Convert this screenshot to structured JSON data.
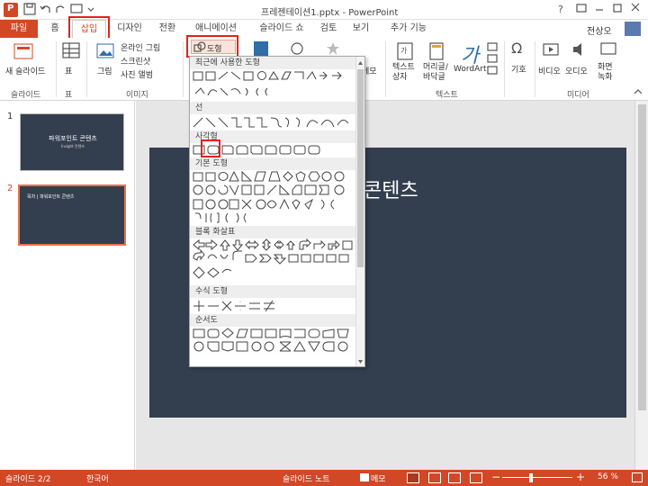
{
  "app": {
    "window_title": "프레젠테이션1.pptx - PowerPoint",
    "user": "전상오",
    "help": "?"
  },
  "tabs": [
    "파일",
    "홈",
    "삽입",
    "디자인",
    "전환",
    "애니메이션",
    "슬라이드 쇼",
    "검토",
    "보기",
    "추가 기능"
  ],
  "active_tab": "삽입",
  "ribbon": {
    "new_slide": "새 슬라이드",
    "table": "표",
    "picture": "그림",
    "online_picture": "온라인 그림",
    "screenshot": "스크린샷",
    "photo_album": "사진 앨범",
    "shapes": "도형",
    "memo": "메모",
    "textbox": "텍스트 상자",
    "header_footer": "머리글/ 바닥글",
    "wordart": "WordArt",
    "symbol": "기호",
    "video": "비디오",
    "audio": "오디오",
    "screen_record": "화면 녹화",
    "groups": {
      "slides": "슬라이드",
      "tables": "표",
      "images": "이미지",
      "text": "텍스트",
      "media": "미디어"
    }
  },
  "shapes_menu": {
    "sections": [
      "최근에 사용한 도형",
      "선",
      "사각형",
      "기본 도형",
      "블록 화살표",
      "수식 도형",
      "순서도"
    ]
  },
  "slides": [
    {
      "num": "1",
      "title": "파워포인트 콘텐츠",
      "subtitle": "Insight 컨텐츠"
    },
    {
      "num": "2",
      "title": "목차 | 파워포인트 콘텐츠"
    }
  ],
  "main_slide": {
    "title": "콘텐츠"
  },
  "statusbar": {
    "slide_info": "슬라이드 2/2",
    "language": "한국어",
    "notes": "슬라이드 노트",
    "comments": "메모",
    "zoom": "56 %"
  },
  "colors": {
    "accent": "#d24726",
    "highlight": "#e2231a",
    "slide_bg": "#333e4f"
  }
}
